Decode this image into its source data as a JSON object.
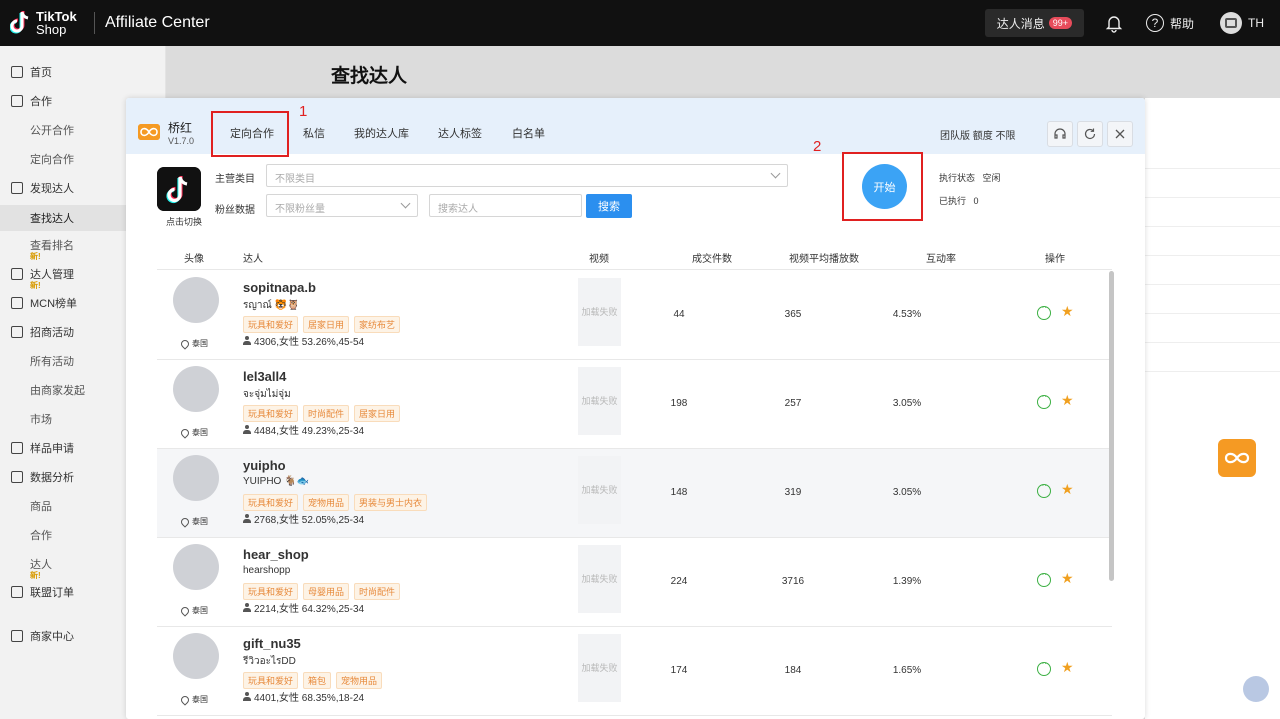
{
  "topbar": {
    "logo_line1": "TikTok",
    "logo_line2": "Shop",
    "app_name": "Affiliate Center",
    "messages_label": "达人消息",
    "messages_badge": "99+",
    "help_label": "帮助",
    "user_initials": "TH"
  },
  "sidebar": {
    "home": "首页",
    "cooperation": "合作",
    "public_coop": "公开合作",
    "targeted_coop": "定向合作",
    "discover": "发现达人",
    "find_creators": "查找达人",
    "rankings": "查看排名",
    "creator_mgmt": "达人管理",
    "mcn": "MCN榜单",
    "campaigns": "招商活动",
    "all_activities": "所有活动",
    "merchant_launched": "由商家发起",
    "market": "市场",
    "samples": "样品申请",
    "data_analysis": "数据分析",
    "products": "商品",
    "coop2": "合作",
    "creators": "达人",
    "affiliate_orders": "联盟订单",
    "merchant_center": "商家中心",
    "new_tag": "新!"
  },
  "page": {
    "title": "查找达人"
  },
  "modal": {
    "brand_name": "桥红",
    "version": "V1.7.0",
    "tabs": [
      "定向合作",
      "私信",
      "我的达人库",
      "达人标签",
      "白名单"
    ],
    "annotation_1": "1",
    "annotation_2": "2",
    "team_info": "团队版  额度 不限",
    "switch_label": "点击切换",
    "category_label": "主营类目",
    "category_placeholder": "不限类目",
    "fans_label": "粉丝数据",
    "fans_placeholder": "不限粉丝量",
    "search_placeholder": "搜索达人",
    "search_button": "搜索",
    "start_button": "开始",
    "exec_status_label": "执行状态",
    "exec_status_value": "空闲",
    "executed_label": "已执行",
    "executed_value": "0"
  },
  "table": {
    "headers": [
      "头像",
      "达人",
      "视频",
      "成交件数",
      "视频平均播放数",
      "互动率",
      "操作"
    ],
    "rows": [
      {
        "username": "sopitnapa.b",
        "nickname": "รญาณ์ 🐯🦉",
        "tags": [
          "玩具和爱好",
          "居家日用",
          "家纺布艺"
        ],
        "stats": "4306,女性 53.26%,45-54",
        "location": "泰国",
        "video": "加载失败",
        "orders": "44",
        "avg_views": "365",
        "engagement": "4.53%"
      },
      {
        "username": "lel3all4",
        "nickname": "จะจุ่มไม่จุ่ม",
        "tags": [
          "玩具和爱好",
          "时尚配件",
          "居家日用"
        ],
        "stats": "4484,女性 49.23%,25-34",
        "location": "泰国",
        "video": "加载失败",
        "orders": "198",
        "avg_views": "257",
        "engagement": "3.05%"
      },
      {
        "username": "yuipho",
        "nickname": "YUIPHO 🐐🐟",
        "tags": [
          "玩具和爱好",
          "宠物用品",
          "男装与男士内衣"
        ],
        "stats": "2768,女性 52.05%,25-34",
        "location": "泰国",
        "video": "加载失败",
        "orders": "148",
        "avg_views": "319",
        "engagement": "3.05%"
      },
      {
        "username": "hear_shop",
        "nickname": "hearshopp",
        "tags": [
          "玩具和爱好",
          "母婴用品",
          "时尚配件"
        ],
        "stats": "2214,女性 64.32%,25-34",
        "location": "泰国",
        "video": "加载失败",
        "orders": "224",
        "avg_views": "3716",
        "engagement": "1.39%"
      },
      {
        "username": "gift_nu35",
        "nickname": "รีวิวอะไรDD",
        "tags": [
          "玩具和爱好",
          "箱包",
          "宠物用品"
        ],
        "stats": "4401,女性 68.35%,18-24",
        "location": "泰国",
        "video": "加载失败",
        "orders": "174",
        "avg_views": "184",
        "engagement": "1.65%"
      }
    ]
  },
  "colors": {
    "accent": "#2b8fef",
    "start_button": "#3ba3f5",
    "annotation": "#e02020",
    "tag_text": "#e7893a",
    "brand": "#f59a23"
  }
}
